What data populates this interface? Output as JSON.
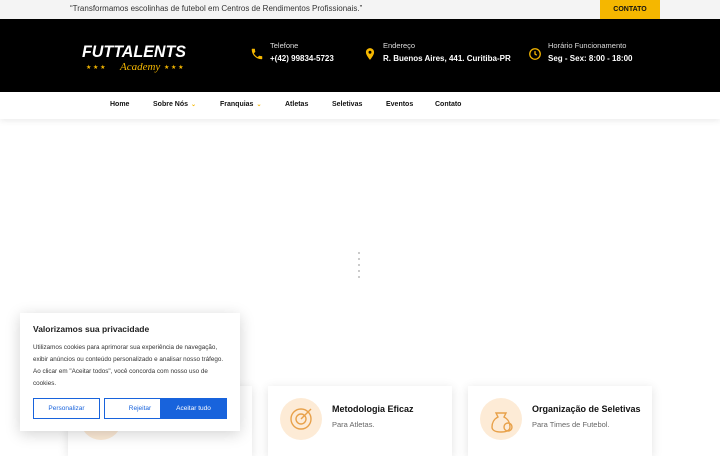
{
  "topbar": {
    "tagline": "“Transformamos escolinhas de futebol em Centros de Rendimentos Profissionais.”",
    "contact_label": "CONTATO"
  },
  "header": {
    "logo": {
      "line1": "FUTTALENTS",
      "line2": "Academy"
    },
    "phone": {
      "label": "Telefone",
      "value": "+(42) 99834-5723",
      "icon": "phone-icon"
    },
    "address": {
      "label": "Endereço",
      "value": "R. Buenos Aires, 441. Curitiba-PR",
      "icon": "map-pin-icon"
    },
    "hours": {
      "label": "Horário Funcionamento",
      "value": "Seg - Sex: 8:00 - 18:00",
      "icon": "clock-icon"
    }
  },
  "nav": {
    "items": [
      {
        "label": "Home"
      },
      {
        "label": "Sobre Nós"
      },
      {
        "label": "Franquias"
      },
      {
        "label": "Atletas"
      },
      {
        "label": "Seletivas"
      },
      {
        "label": "Eventos"
      },
      {
        "label": "Contato"
      }
    ]
  },
  "cards": [
    {
      "title": "",
      "subtitle": ""
    },
    {
      "title": "Metodologia Eficaz",
      "subtitle": "Para Atletas."
    },
    {
      "title": "Organização de Seletivas",
      "subtitle": "Para Times de Futebol."
    }
  ],
  "cookie": {
    "title": "Valorizamos sua privacidade",
    "body": "Utilizamos cookies para aprimorar sua experiência de navegação, exibir anúncios ou conteúdo personalizado e analisar nosso tráfego. Ao clicar em \"Aceitar todos\", você concorda com nosso uso de cookies.",
    "customize": "Personalizar",
    "reject": "Rejeitar",
    "accept": "Aceitar tudo"
  },
  "colors": {
    "accent": "#f5b700",
    "header_bg": "#000000",
    "cookie_button": "#1863dc"
  }
}
